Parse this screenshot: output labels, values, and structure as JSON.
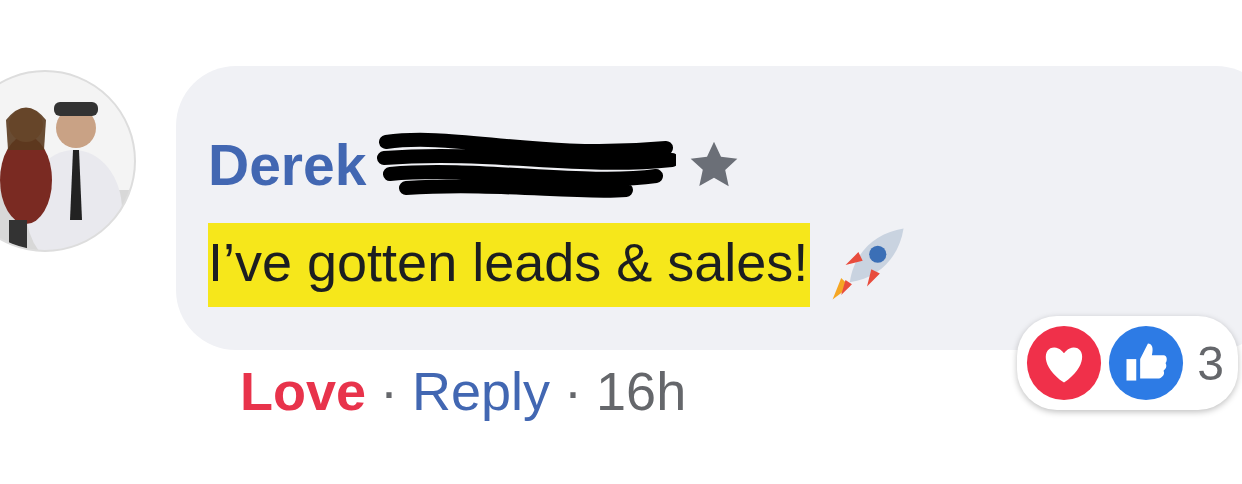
{
  "comment": {
    "author": "Derek",
    "top_fan": true,
    "text": "I’ve gotten leads & sales!",
    "highlighted": true
  },
  "reactions": {
    "count": "3"
  },
  "actions": [
    {
      "kind": "reaction",
      "label": "Love",
      "selected": true
    },
    {
      "kind": "separator",
      "label": "·"
    },
    {
      "kind": "link",
      "label": "Reply"
    },
    {
      "kind": "separator",
      "label": "·"
    },
    {
      "kind": "time",
      "label": "16h"
    }
  ]
}
